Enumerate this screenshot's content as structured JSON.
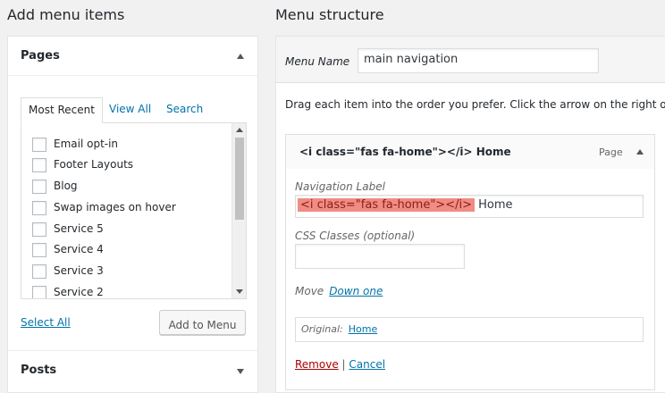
{
  "left": {
    "heading": "Add menu items",
    "pages_panel": {
      "title": "Pages",
      "tabs": [
        {
          "label": "Most Recent"
        },
        {
          "label": "View All"
        },
        {
          "label": "Search"
        }
      ],
      "items": [
        {
          "label": "Email opt-in"
        },
        {
          "label": "Footer Layouts"
        },
        {
          "label": "Blog"
        },
        {
          "label": "Swap images on hover"
        },
        {
          "label": "Service 5"
        },
        {
          "label": "Service 4"
        },
        {
          "label": "Service 3"
        },
        {
          "label": "Service 2"
        }
      ],
      "select_all": "Select All",
      "add_button": "Add to Menu"
    },
    "posts_panel": {
      "title": "Posts"
    }
  },
  "right": {
    "heading": "Menu structure",
    "menu_name_label": "Menu Name",
    "menu_name_value": "main navigation",
    "instructions": "Drag each item into the order you prefer. Click the arrow on the right of the item to reveal additional configuration options.",
    "item": {
      "title": "<i class=\"fas fa-home\"></i> Home",
      "type": "Page",
      "nav_label_label": "Navigation Label",
      "nav_label_highlight": "<i class=\"fas fa-home\"></i>",
      "nav_label_rest": " Home",
      "css_label": "CSS Classes (optional)",
      "css_value": "",
      "move_label": "Move",
      "move_link": "Down one",
      "original_label": "Original:",
      "original_link": "Home",
      "remove": "Remove",
      "separator": "|",
      "cancel": "Cancel"
    }
  }
}
